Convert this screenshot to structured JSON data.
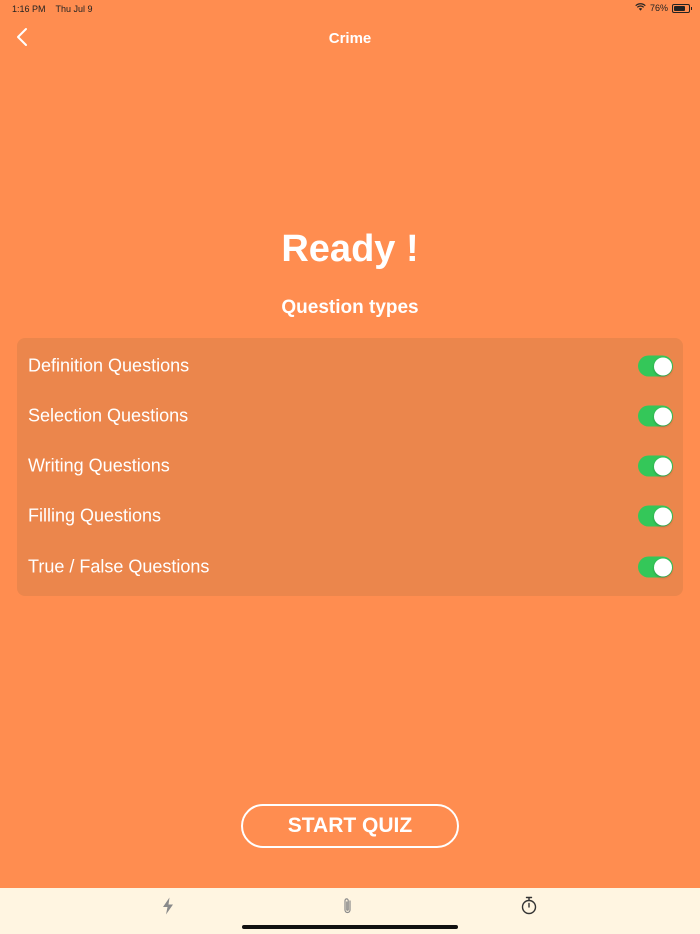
{
  "status_bar": {
    "time": "1:16 PM",
    "date": "Thu Jul 9",
    "battery": "76%",
    "battery_level": 0.76
  },
  "nav": {
    "title": "Crime"
  },
  "main": {
    "heading": "Ready !",
    "subheading": "Question types",
    "options": [
      {
        "label": "Definition Questions",
        "enabled": true
      },
      {
        "label": "Selection Questions",
        "enabled": true
      },
      {
        "label": "Writing Questions",
        "enabled": true
      },
      {
        "label": "Filling Questions",
        "enabled": true
      },
      {
        "label": "True / False Questions",
        "enabled": true
      }
    ],
    "start_button": "START QUIZ"
  },
  "tab_bar": {
    "items": [
      {
        "icon": "bolt-icon"
      },
      {
        "icon": "paperclip-icon"
      },
      {
        "icon": "stopwatch-icon"
      }
    ]
  },
  "colors": {
    "background": "#FF8D50",
    "panel": "#EB864C",
    "toggle_on": "#34C759",
    "tab_bar": "#FFF5E1"
  }
}
